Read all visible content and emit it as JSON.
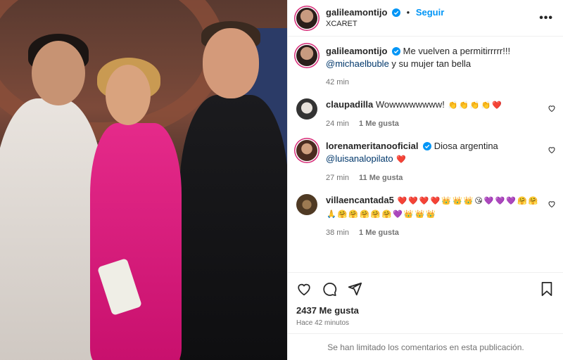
{
  "post": {
    "username": "galileamontijo",
    "follow_label": "Seguir",
    "separator": "•",
    "location": "XCARET",
    "more_label": "•••"
  },
  "caption": {
    "username": "galileamontijo",
    "text": "Me vuelven a permitirrrrr!!! ",
    "mention": "@michaelbuble",
    "text_after": " y su mujer tan bella",
    "time": "42 min"
  },
  "comments": [
    {
      "username": "claupadilla",
      "text": "Wowwwwwwww! ",
      "emojis": [
        "👏",
        "👏",
        "👏",
        "👏",
        "❤️"
      ],
      "time": "24 min",
      "likes": "1 Me gusta",
      "verified": false
    },
    {
      "username": "lorenameritanooficial",
      "text": "Diosa argentina ",
      "mention": "@luisanalopilato",
      "emojis": [
        "❤️"
      ],
      "time": "27 min",
      "likes": "11 Me gusta",
      "verified": true
    },
    {
      "username": "villaencantada5",
      "text": "",
      "emojis": [
        "❤️",
        "❤️",
        "❤️",
        "❤️",
        "👑",
        "👑",
        "👑",
        "😘",
        "💜",
        "💜",
        "💜",
        "🤗",
        "🤗",
        "🙏",
        "🤗",
        "🤗",
        "🤗",
        "🤗",
        "🤗",
        "💜",
        "👑",
        "👑",
        "👑"
      ],
      "time": "38 min",
      "likes": "1 Me gusta",
      "verified": false
    }
  ],
  "stats": {
    "likes": "2437 Me gusta",
    "time_ago": "Hace 42 minutos"
  },
  "footer": {
    "limited_text": "Se han limitado los comentarios en esta publicación."
  },
  "colors": {
    "accent": "#0095f6",
    "mention": "#00376b",
    "heart": "#ed4956",
    "muted": "#737373"
  }
}
